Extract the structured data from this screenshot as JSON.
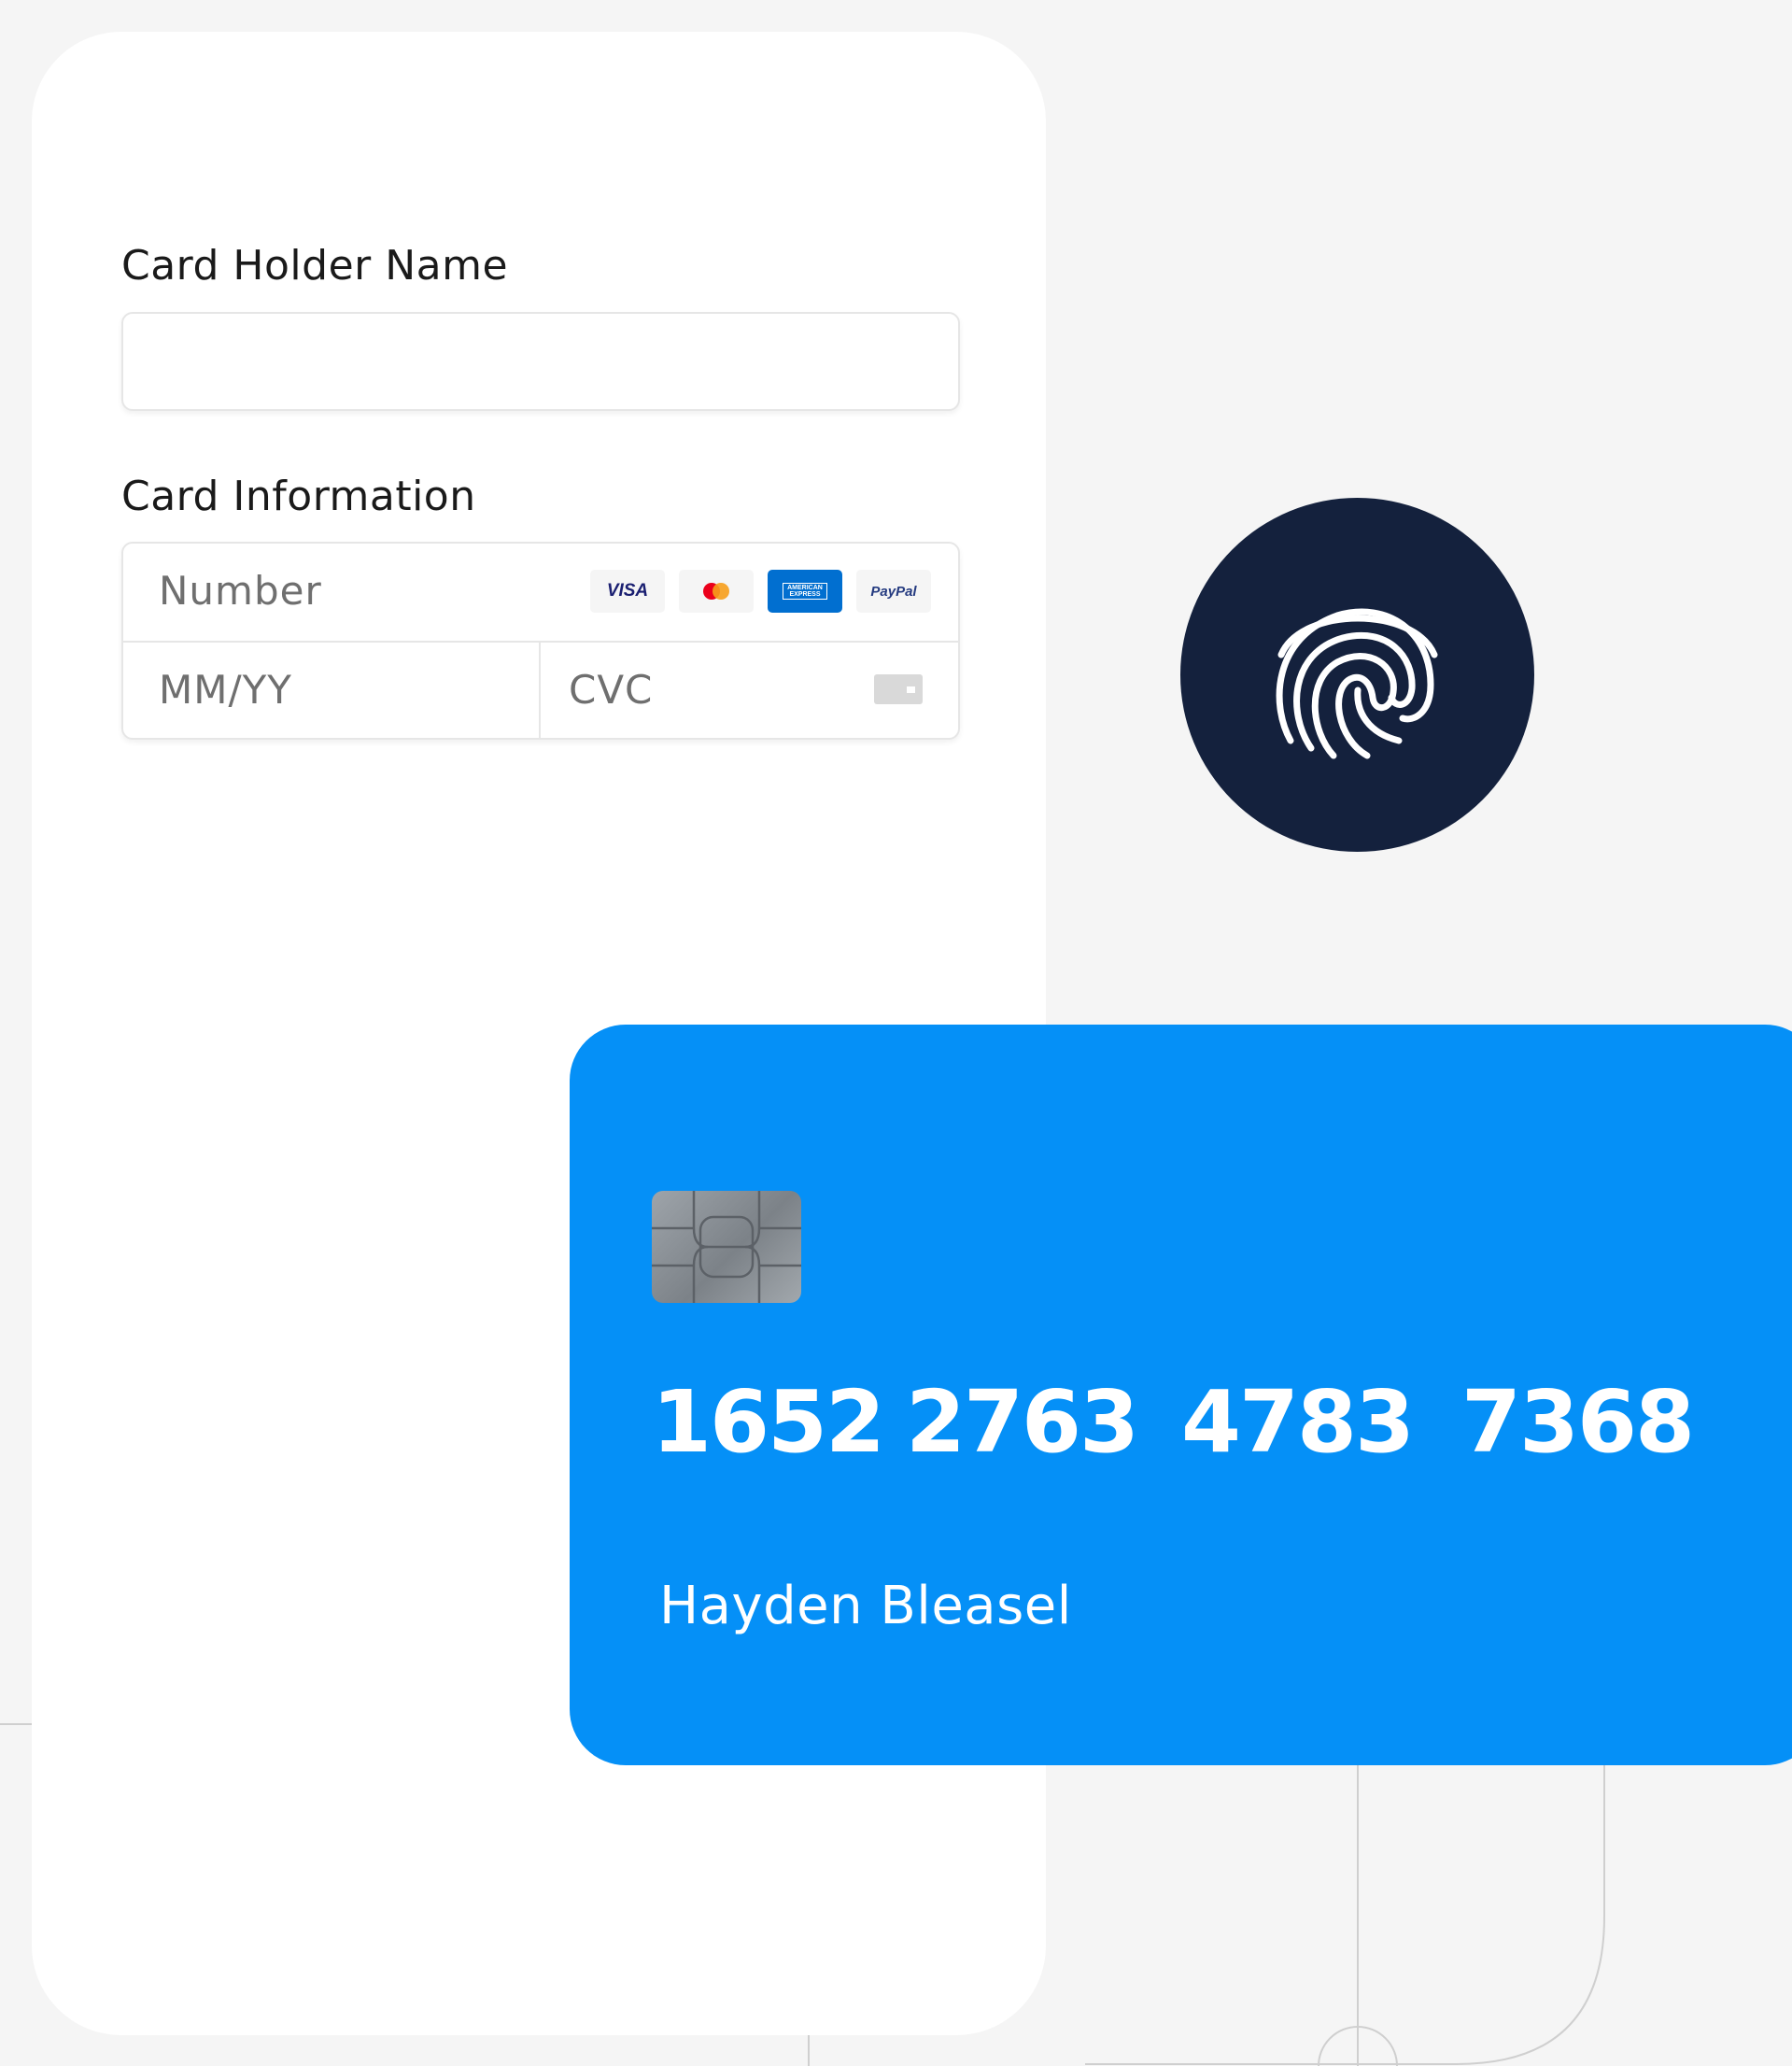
{
  "form": {
    "card_holder_label": "Card Holder Name",
    "card_holder_value": "",
    "card_info_label": "Card Information",
    "number_placeholder": "Number",
    "expiry_placeholder": "MM/YY",
    "cvc_placeholder": "CVC",
    "brands": [
      {
        "name": "VISA",
        "icon": "visa-logo"
      },
      {
        "name": "mastercard",
        "icon": "mastercard-logo"
      },
      {
        "name": "AMERICAN EXPRESS",
        "icon": "amex-logo"
      },
      {
        "name": "PayPal",
        "icon": "paypal-logo"
      }
    ]
  },
  "biometric": {
    "icon": "fingerprint-icon"
  },
  "card": {
    "number_groups": [
      "1652",
      "2763",
      "4783",
      "7368"
    ],
    "holder_name": "Hayden Bleasel"
  },
  "colors": {
    "background": "#f5f5f5",
    "card_blue": "#0590f7",
    "fingerprint_bg": "#14213d",
    "amex_blue": "#016fd0",
    "visa_blue": "#1a1f71"
  }
}
